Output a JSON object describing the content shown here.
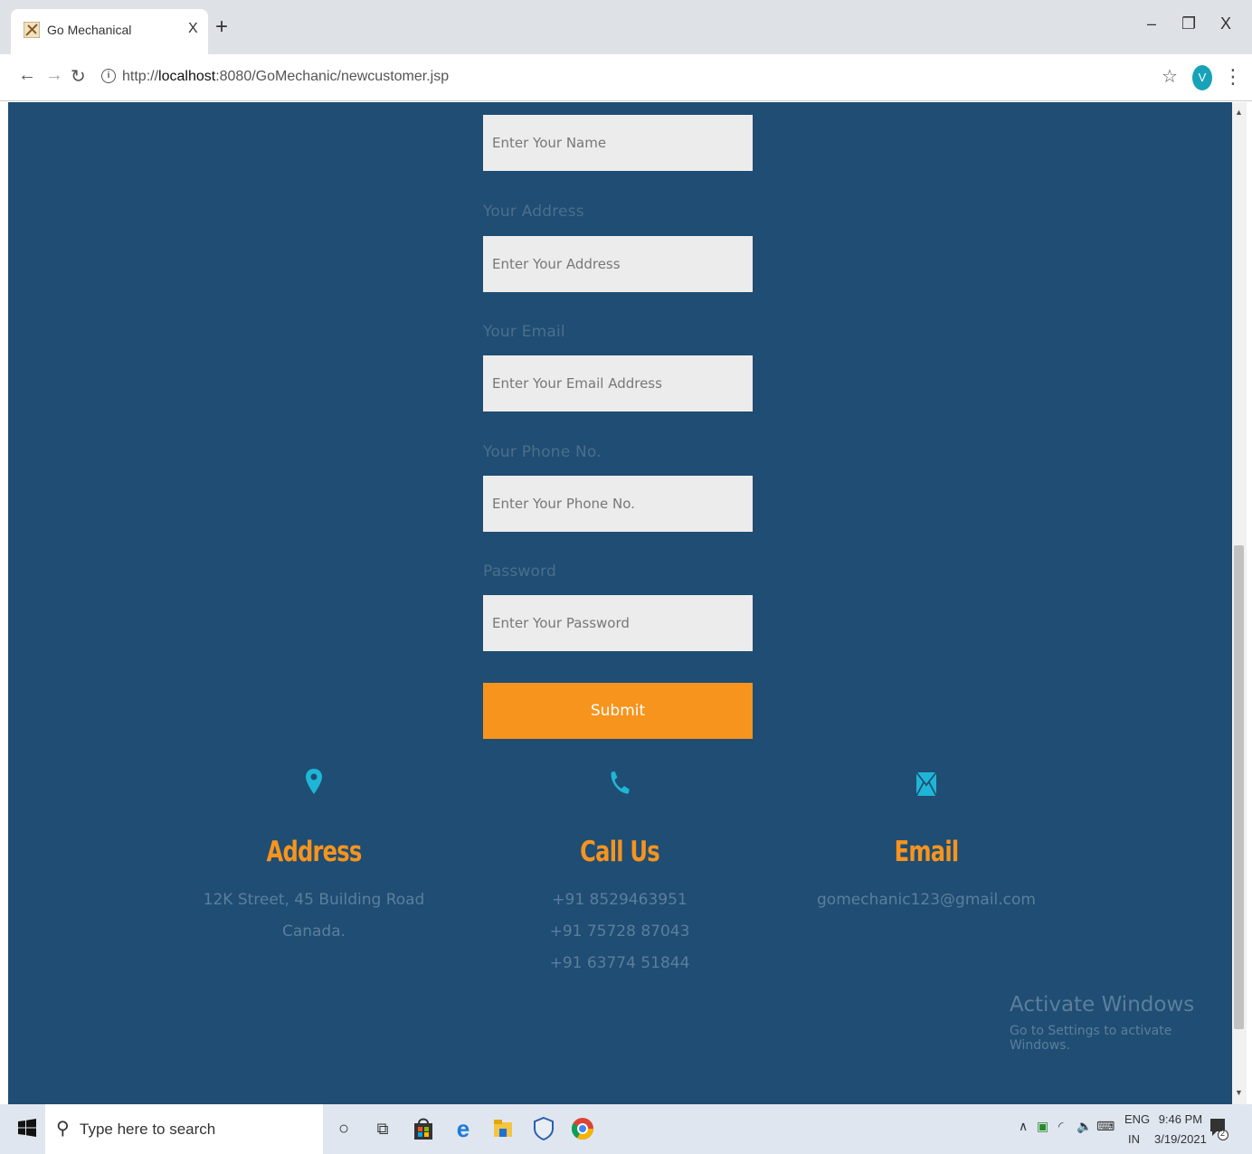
{
  "browser": {
    "tab_title": "Go Mechanical",
    "tab_close": "X",
    "new_tab": "+",
    "url_prefix": "http://",
    "url_host": "localhost",
    "url_path": ":8080/GoMechanic/newcustomer.jsp",
    "avatar_letter": "V",
    "window_minimize": "–",
    "window_maximize": "❐",
    "window_close": "X"
  },
  "form": {
    "name_placeholder": "Enter Your Name",
    "address_label": "Your Address",
    "address_placeholder": "Enter Your Address",
    "email_label": "Your Email",
    "email_placeholder": "Enter Your Email Address",
    "phone_label": "Your Phone No.",
    "phone_placeholder": "Enter Your Phone No.",
    "password_label": "Password",
    "password_placeholder": "Enter Your Password",
    "submit_label": "Submit"
  },
  "contacts": {
    "address": {
      "icon": "map-pin-icon",
      "title": "Address",
      "lines": [
        "12K Street, 45 Building Road",
        "Canada."
      ]
    },
    "call": {
      "icon": "phone-icon",
      "title": "Call Us",
      "lines": [
        "+91 8529463951",
        "+91 75728 87043",
        "+91 63774 51844"
      ]
    },
    "email": {
      "icon": "envelope-icon",
      "title": "Email",
      "lines": [
        "gomechanic123@gmail.com"
      ]
    }
  },
  "watermark": {
    "title": "Activate Windows",
    "subtitle": "Go to Settings to activate Windows."
  },
  "taskbar": {
    "search_placeholder": "Type here to search",
    "lang_top": "ENG",
    "lang_bottom": "IN",
    "time": "9:46 PM",
    "date": "3/19/2021",
    "notification_count": "2"
  },
  "colors": {
    "page_bg": "#1f4d73",
    "accent_orange": "#f7941d",
    "icon_cyan": "#1fb6d6"
  }
}
